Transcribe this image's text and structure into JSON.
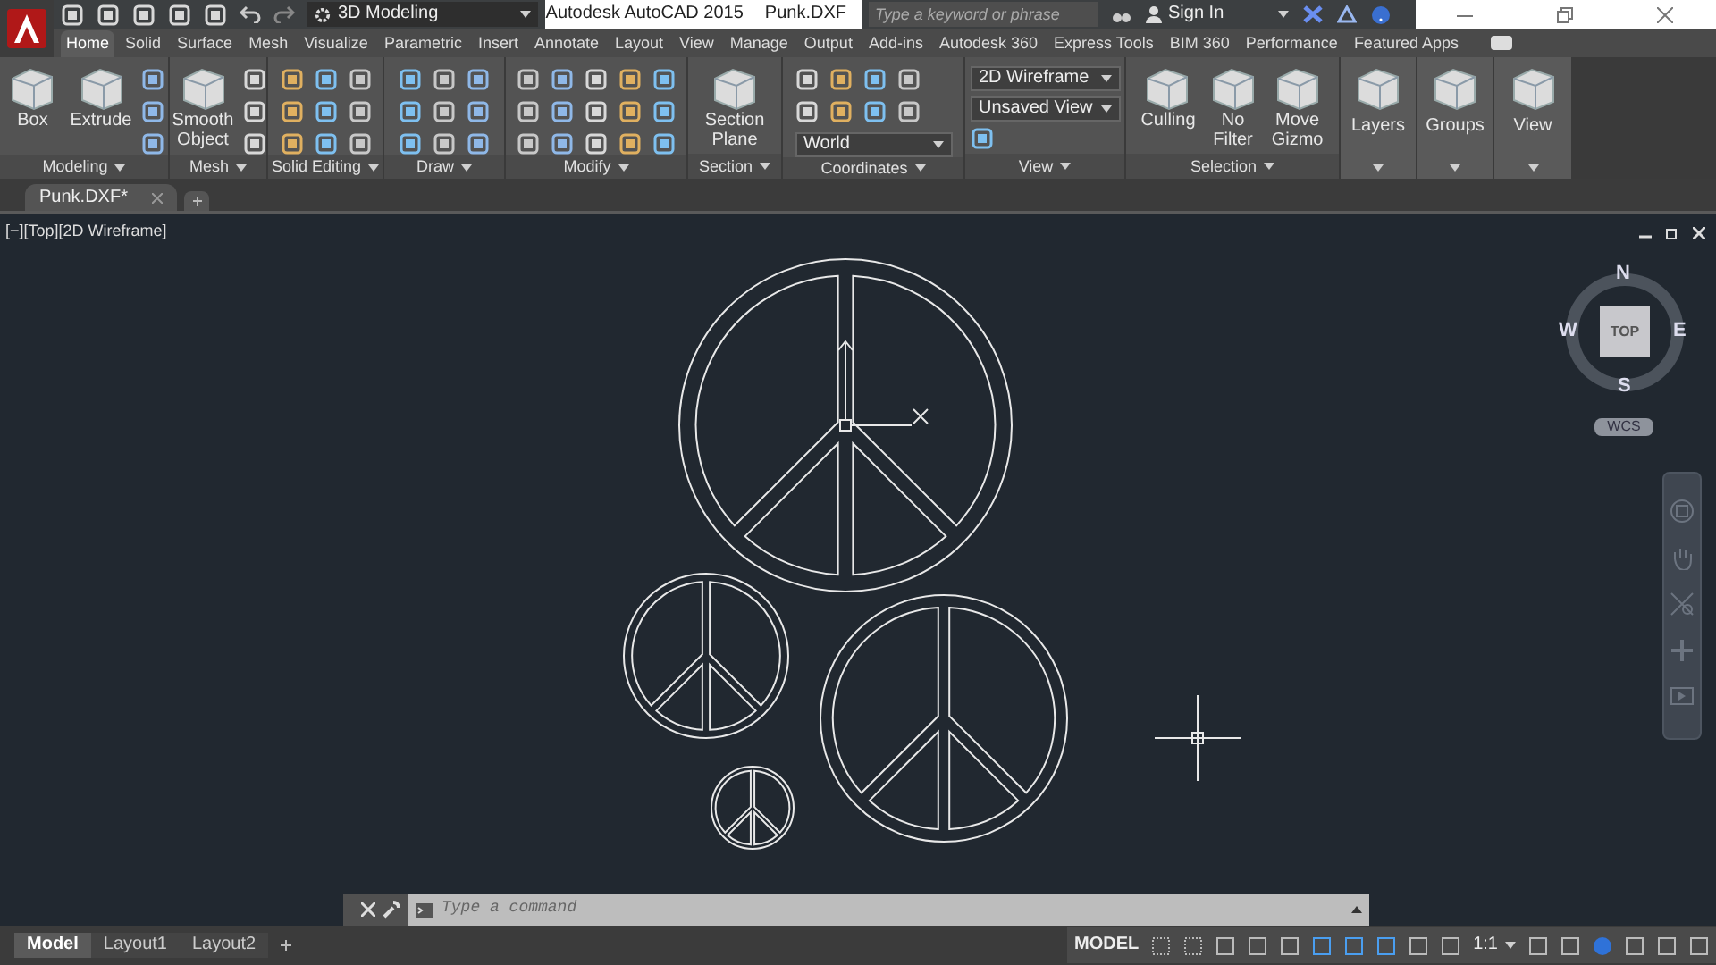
{
  "title_bar": {
    "workspace": "3D Modeling",
    "app_title": "Autodesk AutoCAD 2015",
    "file_name": "Punk.DXF",
    "search": {
      "placeholder": "Type a keyword or phrase"
    },
    "sign_in": "Sign In"
  },
  "ribbon_tabs": [
    {
      "label": "Home",
      "selected": true
    },
    {
      "label": "Solid",
      "selected": false
    },
    {
      "label": "Surface",
      "selected": false
    },
    {
      "label": "Mesh",
      "selected": false
    },
    {
      "label": "Visualize",
      "selected": false
    },
    {
      "label": "Parametric",
      "selected": false
    },
    {
      "label": "Insert",
      "selected": false
    },
    {
      "label": "Annotate",
      "selected": false
    },
    {
      "label": "Layout",
      "selected": false
    },
    {
      "label": "View",
      "selected": false
    },
    {
      "label": "Manage",
      "selected": false
    },
    {
      "label": "Output",
      "selected": false
    },
    {
      "label": "Add-ins",
      "selected": false
    },
    {
      "label": "Autodesk 360",
      "selected": false
    },
    {
      "label": "Express Tools",
      "selected": false
    },
    {
      "label": "BIM 360",
      "selected": false
    },
    {
      "label": "Performance",
      "selected": false
    },
    {
      "label": "Featured Apps",
      "selected": false
    }
  ],
  "ribbon_panels": [
    {
      "kind": "tools",
      "title": "Modeling",
      "buttons": [
        "Box",
        "Extrude"
      ]
    },
    {
      "kind": "tools",
      "title": "Mesh",
      "buttons": [
        "Smooth Object"
      ]
    },
    {
      "kind": "tools",
      "title": "Solid Editing"
    },
    {
      "kind": "tools",
      "title": "Draw"
    },
    {
      "kind": "tools",
      "title": "Modify"
    },
    {
      "kind": "tools",
      "title": "Section",
      "buttons": [
        "Section Plane"
      ]
    },
    {
      "kind": "tools",
      "title": "Coordinates",
      "dropdowns": [
        "World"
      ]
    },
    {
      "kind": "tools",
      "title": "View",
      "dropdowns": [
        "2D Wireframe",
        "Unsaved View"
      ]
    },
    {
      "kind": "tools",
      "title": "Selection",
      "buttons": [
        "Culling",
        "No Filter",
        "Move Gizmo"
      ]
    },
    {
      "kind": "collapsed",
      "buttons": [
        "Layers"
      ]
    },
    {
      "kind": "collapsed",
      "buttons": [
        "Groups"
      ]
    },
    {
      "kind": "collapsed",
      "buttons": [
        "View"
      ]
    }
  ],
  "file_tabs": [
    {
      "label": "Punk.DXF*",
      "selected": true
    }
  ],
  "viewport": {
    "label": "[−][Top][2D Wireframe]",
    "viewcube": {
      "face": "TOP",
      "north": "N",
      "south": "S",
      "east": "E",
      "west": "W",
      "ucs": "WCS"
    }
  },
  "command_line": {
    "placeholder": "Type a command"
  },
  "layout_tabs": [
    {
      "label": "Model",
      "selected": true
    },
    {
      "label": "Layout1",
      "selected": false
    },
    {
      "label": "Layout2",
      "selected": false
    }
  ],
  "status_bar": {
    "space": "MODEL",
    "scale": "1:1"
  }
}
